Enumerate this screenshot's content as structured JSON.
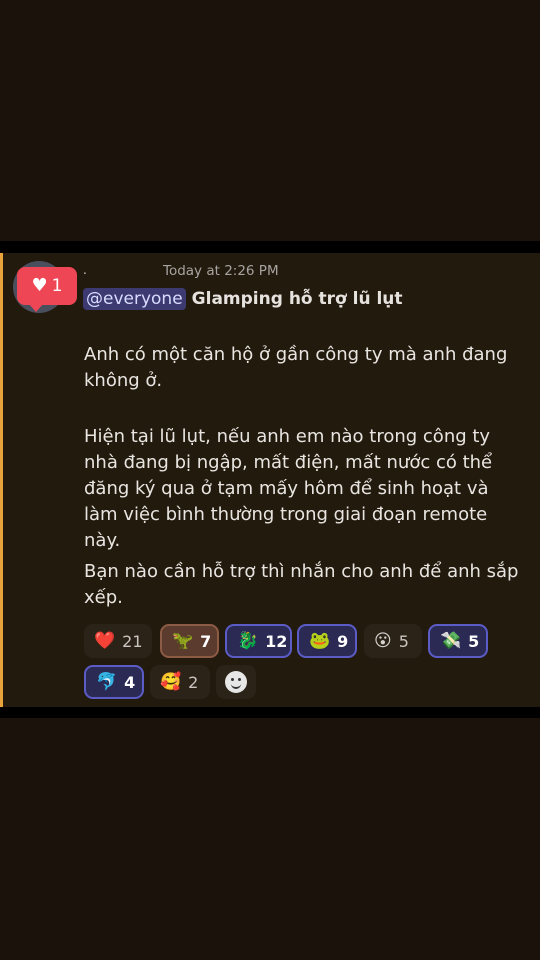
{
  "header": {
    "author_dot": ".",
    "timestamp": "Today at 2:26 PM",
    "like_count": "1",
    "like_icon": "heart-icon"
  },
  "message": {
    "mention": "@everyone",
    "title": "Glamping hỗ trợ lũ lụt",
    "paragraphs": [
      "Anh có một căn hộ ở gần công ty mà anh đang không ở.",
      "Hiện tại lũ lụt, nếu anh em nào trong công ty nhà đang bị ngập, mất điện, mất nước có thể đăng ký qua ở tạm mấy hôm để sinh hoạt và làm việc bình thường trong giai đoạn remote này.",
      "Bạn nào cần hỗ trợ thì nhắn cho anh để anh sắp xếp."
    ]
  },
  "reactions": [
    {
      "icon": "red-heart-emoji",
      "glyph": "❤️",
      "count": "21"
    },
    {
      "icon": "custom-creature-emoji",
      "glyph": "🦖",
      "count": "7"
    },
    {
      "icon": "custom-creature-emoji",
      "glyph": "🐉",
      "count": "12"
    },
    {
      "icon": "custom-frog-emoji",
      "glyph": "🐸",
      "count": "9"
    },
    {
      "icon": "custom-face-emoji",
      "glyph": "😮",
      "count": "5"
    },
    {
      "icon": "custom-money-emoji",
      "glyph": "💸",
      "count": "5"
    },
    {
      "icon": "custom-fish-emoji",
      "glyph": "🐬",
      "count": "4"
    },
    {
      "icon": "hugging-face-emoji",
      "glyph": "🥰",
      "count": "2"
    }
  ],
  "add_reaction_icon": "smiley-add-reaction-icon",
  "colors": {
    "accent_bar": "#e8a33a",
    "like_badge": "#ef4655",
    "mention_bg": "#3d3a72",
    "selected_border": "#5b5cc6"
  }
}
